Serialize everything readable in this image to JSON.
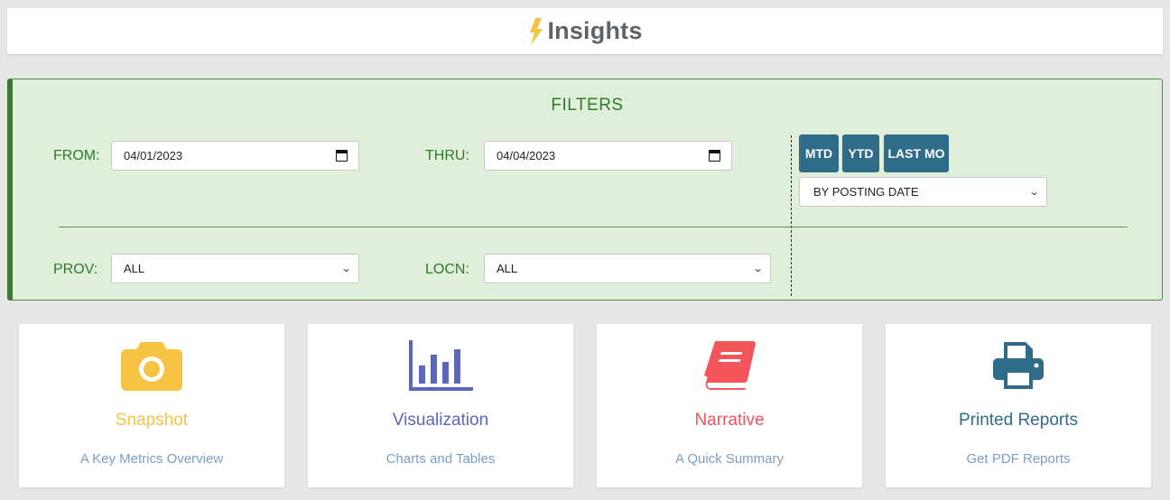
{
  "app": {
    "title": "Insights"
  },
  "filters": {
    "title": "FILTERS",
    "from_label": "FROM:",
    "from_value": "04/01/2023",
    "thru_label": "THRU:",
    "thru_value": "04/04/2023",
    "quick_buttons": [
      "MTD",
      "YTD",
      "LAST MO"
    ],
    "date_basis": "BY POSTING DATE",
    "prov_label": "PROV:",
    "prov_value": "ALL",
    "locn_label": "LOCN:",
    "locn_value": "ALL"
  },
  "cards": [
    {
      "title": "Snapshot",
      "subtitle": "A Key Metrics Overview",
      "icon": "camera-icon",
      "color": "#f6c343"
    },
    {
      "title": "Visualization",
      "subtitle": "Charts and Tables",
      "icon": "bar-chart-icon",
      "color": "#5a67bd"
    },
    {
      "title": "Narrative",
      "subtitle": "A Quick Summary",
      "icon": "book-icon",
      "color": "#f2555a"
    },
    {
      "title": "Printed Reports",
      "subtitle": "Get PDF Reports",
      "icon": "printer-icon",
      "color": "#2f6c8a"
    }
  ],
  "colors": {
    "filters_bg": "#dfefda",
    "filters_accent": "#2f7a2b",
    "button_bg": "#2f6c8a",
    "subtitle": "#7a9fc2"
  }
}
